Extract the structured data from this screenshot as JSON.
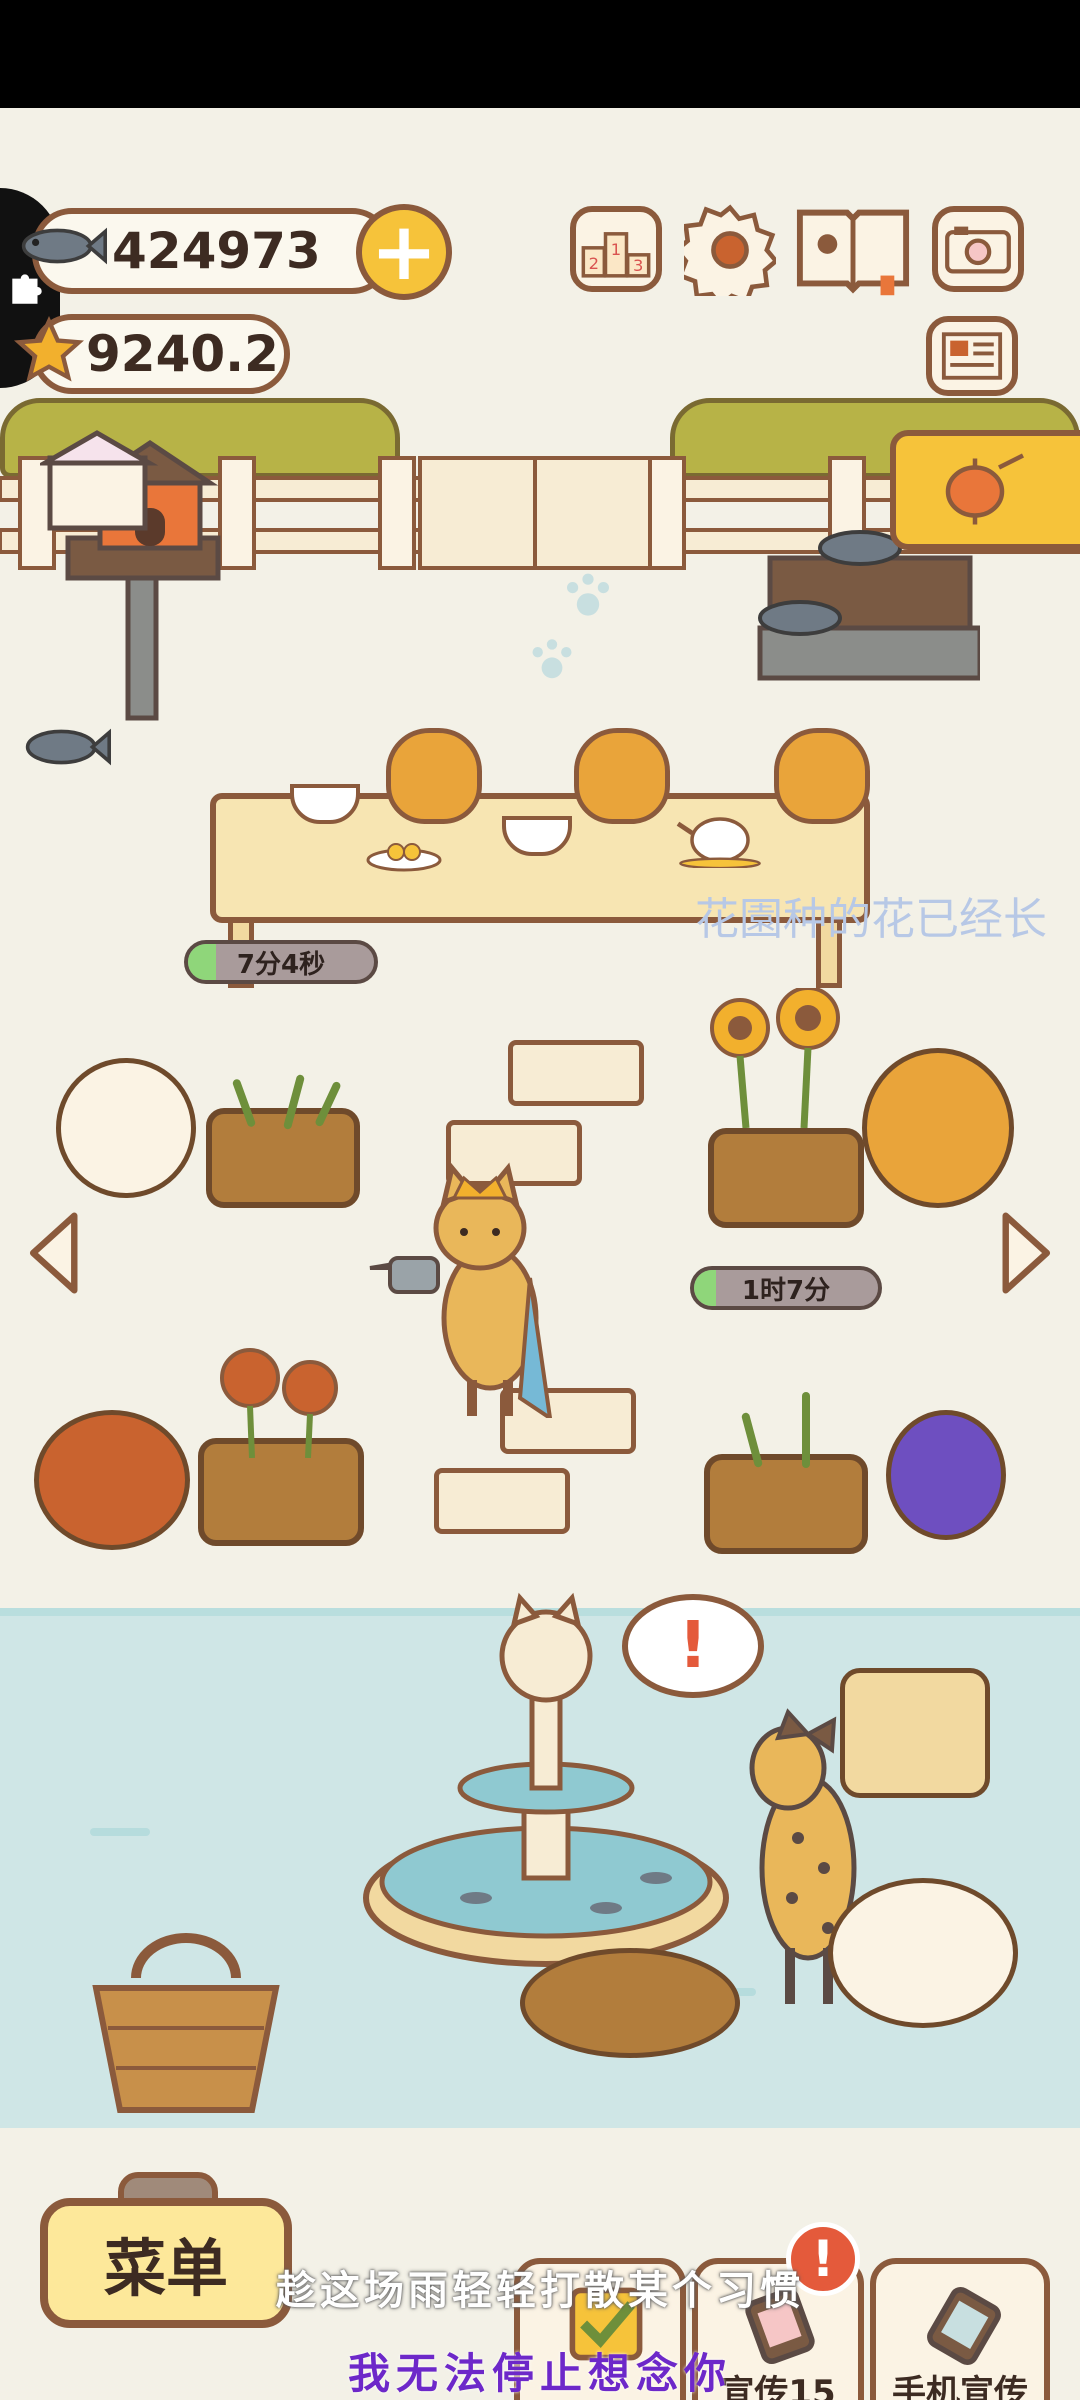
{
  "hud": {
    "fish_currency": "424973",
    "star_currency": "9240.2",
    "rank_icon_label": "213"
  },
  "timers": {
    "table_timer": "7分4秒",
    "table_timer_progress": 0.15,
    "flower_timer": "1时7分",
    "flower_timer_progress": 0.12
  },
  "floating_notice": "花園种的花已经长",
  "bottom": {
    "menu_label": "菜单",
    "promo_button_label": "宣传",
    "promo_count": "15",
    "phone_promo_label": "手机宣传",
    "alert_symbol": "!"
  },
  "subtitles": {
    "line1": "趁这场雨轻轻打散某个习惯",
    "line2": "我无法停止想念你"
  },
  "colors": {
    "scene_bg": "#f3f1e7",
    "outline": "#8b5a3c",
    "accent_yellow": "#f6c33a",
    "water": "#cfe6e6",
    "subtitle_purple": "#6d28c9"
  }
}
